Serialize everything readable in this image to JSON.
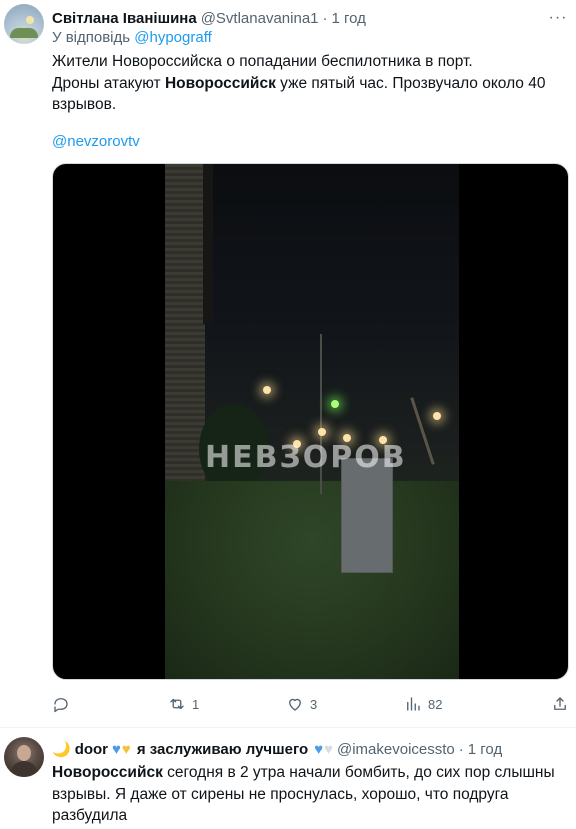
{
  "tweet": {
    "display_name": "Світлана Іванішина",
    "handle": "@Svtlanavanina1",
    "separator": "·",
    "time": "1 год",
    "reply_prefix": "У відповідь",
    "reply_handle": "@hypograff",
    "text_line1": "Жители Новороссийска о попадании беспилотника в порт.",
    "text_line2_pre": "Дроны атакуют ",
    "text_line2_bold": "Новороссийск",
    "text_line2_post": "  уже пятый час. Прозвучало около 40 взрывов.",
    "mention": "@nevzorovtv",
    "more_icon": "more-horizontal-icon",
    "media": {
      "watermark": "НЕВЗОРОВ"
    },
    "actions": {
      "reply_count": "",
      "retweet_count": "1",
      "like_count": "3",
      "views_count": "82"
    }
  },
  "tweet2": {
    "moon": "🌙",
    "display_name": "door",
    "middle_text": "я заслуживаю лучшего",
    "handle": "@imakevoicessto",
    "separator": "·",
    "time": "1 год",
    "text_bold": "Новороссийск",
    "text_rest": " сегодня в 2 утра начали бомбить, до сих пор слышны взрывы. Я даже от сирены не проснулась, хорошо, что подруга разбудила"
  },
  "colors": {
    "link": "#1d9bf0",
    "secondary": "#536471",
    "primary": "#0f1419"
  }
}
